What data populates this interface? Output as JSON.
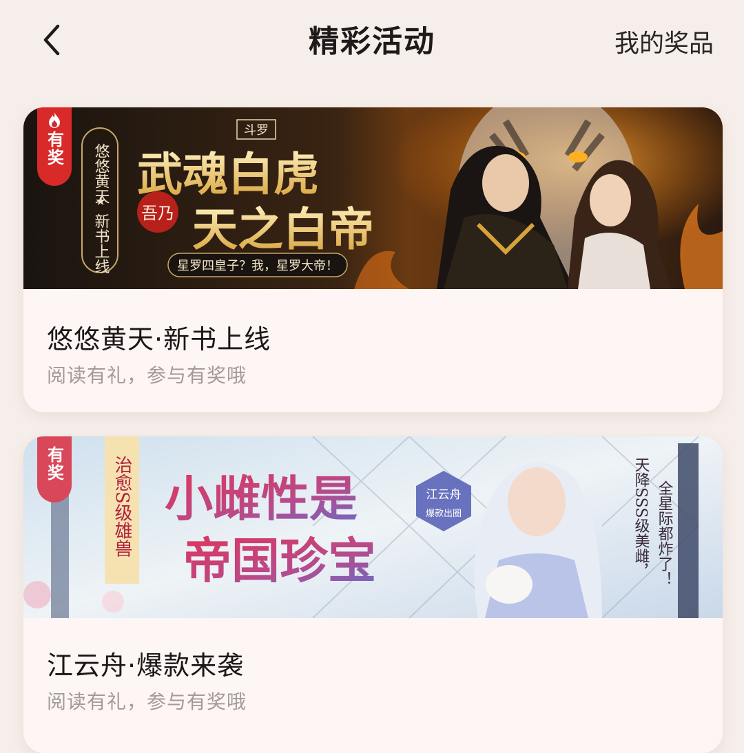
{
  "header": {
    "back_icon": "chevron-left-icon",
    "title": "精彩活动",
    "prizes_label": "我的奖品"
  },
  "cards": [
    {
      "badge": "有奖",
      "badge_color": "#d92a2a",
      "banner": {
        "series_tag": "斗罗",
        "headline_1": "武魂白虎",
        "headline_2": "天之白帝",
        "seal": "吾乃",
        "tagline": "星罗四皇子？我，星罗大帝！",
        "side_author": "悠悠黄天",
        "side_star": "★",
        "side_note": "新书上线"
      },
      "title": "悠悠黄天·新书上线",
      "subtitle": "阅读有礼，参与有奖哦"
    },
    {
      "badge": "有奖",
      "badge_color": "#d8485a",
      "banner": {
        "ribbon": "治愈S级雄兽",
        "headline_1": "小雌性是",
        "headline_2": "帝国珍宝",
        "stamp_1": "江云舟",
        "stamp_2": "爆款出圈",
        "side_1": "天降SSS级美雌，",
        "side_2": "全星际都炸了！"
      },
      "title": "江云舟·爆款来袭",
      "subtitle": "阅读有礼，参与有奖哦"
    }
  ]
}
